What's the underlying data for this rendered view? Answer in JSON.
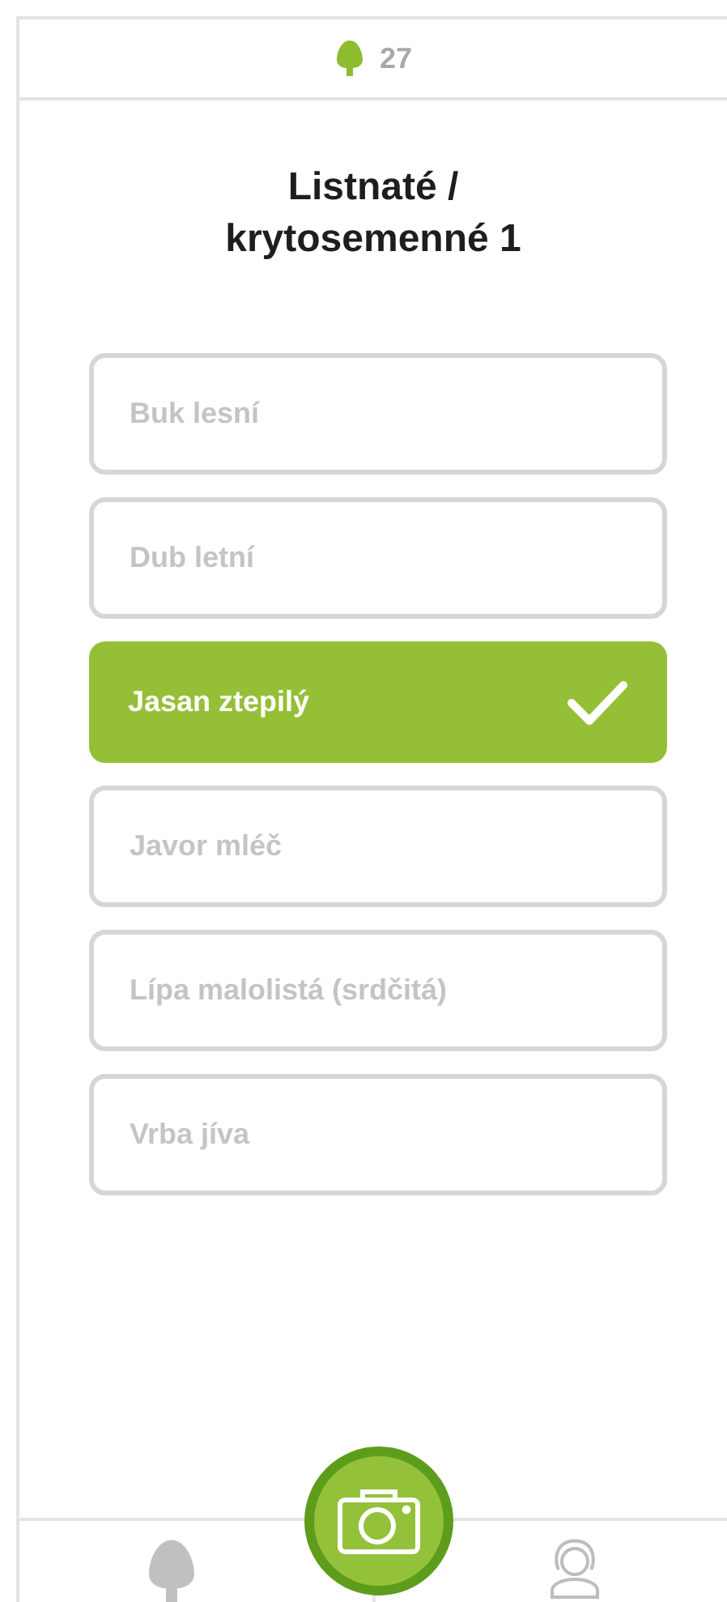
{
  "header": {
    "count": "27"
  },
  "title": "Listnaté / krytosemenné 1",
  "options": [
    {
      "label": "Buk lesní",
      "selected": false
    },
    {
      "label": "Dub letní",
      "selected": false
    },
    {
      "label": "Jasan ztepilý",
      "selected": true
    },
    {
      "label": "Javor mléč",
      "selected": false
    },
    {
      "label": "Lípa malolistá (srdčitá)",
      "selected": false
    },
    {
      "label": "Vrba jíva",
      "selected": false
    }
  ]
}
